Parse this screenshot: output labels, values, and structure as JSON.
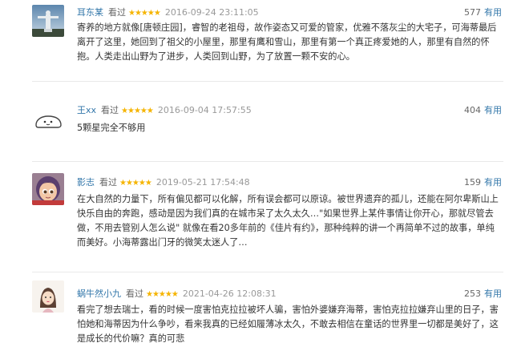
{
  "colors": {
    "link": "#3377aa",
    "star": "#f5b400",
    "meta": "#999999",
    "text": "#333333"
  },
  "comments": [
    {
      "user": "耳东某",
      "status": "看过",
      "stars": "★★★★★",
      "date": "2016-09-24 23:11:05",
      "votes": "577",
      "useful_label": "有用",
      "avatar": "avatar-statue-icon",
      "text": "寄养的地方就像[唐顿庄园]，睿智的老祖母，故作姿态又可爱的管家，优雅不落灰尘的大宅子，可海蒂最后离开了这里，她回到了祖父的小屋里，那里有鹰和雪山，那里有第一个真正疼爱她的人，那里有自然的怀抱。人类走出山野为了进步，人类回到山野，为了放置一颗不安的心。"
    },
    {
      "user": "王xx",
      "status": "看过",
      "stars": "★★★★★",
      "date": "2016-09-04 17:57:55",
      "votes": "404",
      "useful_label": "有用",
      "avatar": "avatar-cloud-icon",
      "text": "5颗星完全不够用"
    },
    {
      "user": "影志",
      "status": "看过",
      "stars": "★★★★★",
      "date": "2019-05-21 17:54:48",
      "votes": "159",
      "useful_label": "有用",
      "avatar": "avatar-cartoon-girl-icon",
      "text": "在大自然的力量下，所有偏见都可以化解，所有误会都可以原谅。被世界遗弃的孤儿，还能在阿尔卑斯山上快乐自由的奔跑，感动是因为我们真的在城市呆了太久太久…\"如果世界上某件事情让你开心，那就尽管去做，不用去管别人怎么说\" 就像在看20多年前的《佳片有约》，那种纯粹的讲一个再简单不过的故事，单纯而美好。小海蒂露出门牙的微笑太迷人了…"
    },
    {
      "user": "蜗牛然小九",
      "status": "看过",
      "stars": "★★★★★",
      "date": "2021-04-26 12:08:31",
      "votes": "253",
      "useful_label": "有用",
      "avatar": "avatar-doodle-girl-icon",
      "text": "看完了想去瑞士，看的时候一度害怕克拉拉被坏人骗，害怕外婆嫌弃海蒂，害怕克拉拉嫌弃山里的日子，害怕她和海蒂因为什么争吵，看来我真的已经如履薄冰太久，不敢去相信在童话的世界里一切都是美好了，这是成长的代价嘛？真的可悲"
    }
  ]
}
